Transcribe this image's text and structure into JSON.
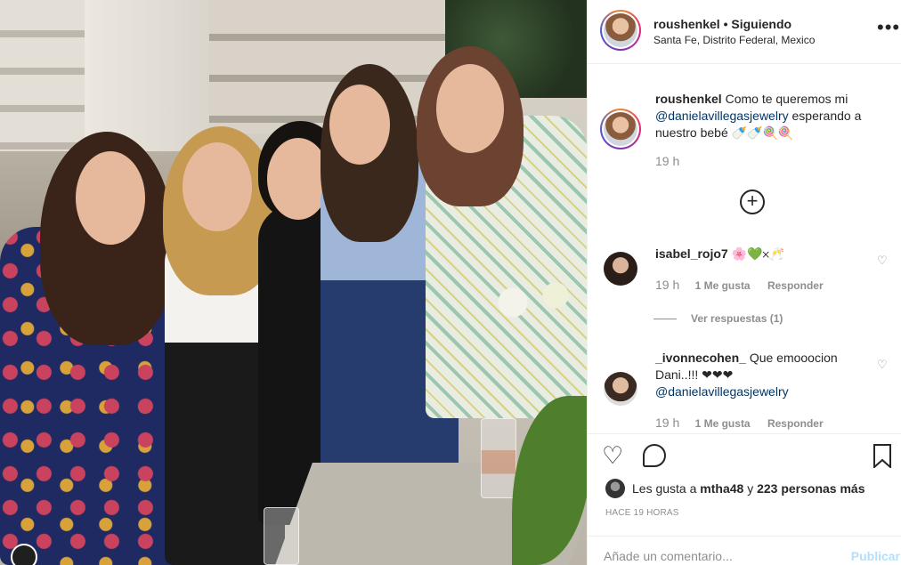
{
  "post": {
    "username": "roushenkel",
    "follow_status": "• Siguiendo",
    "location": "Santa Fe, Distrito Federal, Mexico",
    "more_icon": "ellipsis-icon"
  },
  "caption": {
    "username": "roushenkel",
    "text": "Como te queremos mi",
    "mention": "@danielavillegasjewelry",
    "text_after": "esperando a nuestro bebé 🍼🍼🍭🍭",
    "time": "19 h"
  },
  "load_more_icon": "plus-circle-icon",
  "comments": [
    {
      "username": "isabel_rojo7",
      "text": "🌸💚𐄂🥂",
      "time": "19 h",
      "likes": "1 Me gusta",
      "reply": "Responder"
    },
    {
      "username": "_ivonnecohen_",
      "text": "Que emooocion Dani..!!! ❤❤❤",
      "mention": "@danielavillegasjewelry",
      "time": "19 h",
      "likes": "1 Me gusta",
      "reply": "Responder"
    }
  ],
  "view_replies": "Ver respuestas (1)",
  "likes": {
    "prefix": "Les gusta a",
    "user": "mtha48",
    "middle": "y",
    "count_text": "223 personas más"
  },
  "posted_ago": "HACE 19 HORAS",
  "add_comment": {
    "placeholder": "Añade un comentario...",
    "publish_label": "Publicar"
  },
  "colors": {
    "text": "#262626",
    "secondary": "#8e8e8e",
    "publish_disabled": "#b2dffc",
    "heart_red": "#ed4956"
  }
}
